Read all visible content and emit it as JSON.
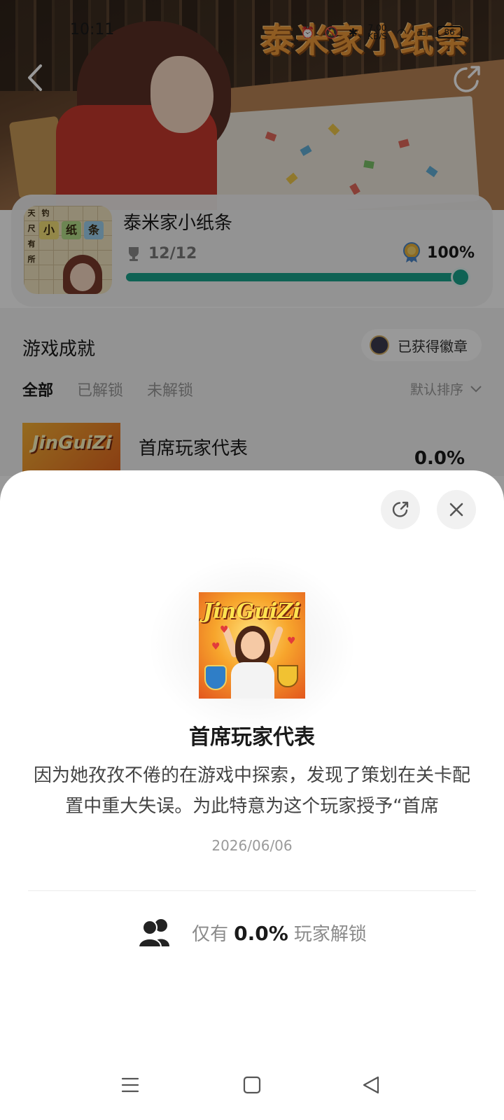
{
  "status_bar": {
    "time": "10:11",
    "network_speed": "7.00",
    "network_unit": "KB/S",
    "battery": "86"
  },
  "hero": {
    "banner_title": "泰米家小纸条"
  },
  "game": {
    "name": "泰米家小纸条",
    "trophies": "12/12",
    "completion": "100%",
    "completion_fraction": 1.0,
    "thumb_tiles": [
      "小",
      "纸",
      "条"
    ],
    "thumb_side_chars": [
      "天",
      "钓",
      "尺",
      "有",
      "所"
    ]
  },
  "achievements": {
    "title": "游戏成就",
    "badge_button": "已获得徽章",
    "tabs": [
      "全部",
      "已解锁",
      "未解锁"
    ],
    "sort_label": "默认排序",
    "first_item": {
      "logo": "JinGuiZi",
      "name": "首席玩家代表",
      "percent": "0.0%"
    }
  },
  "sheet": {
    "image_logo": "JinGuiZi",
    "title": "首席玩家代表",
    "description": "因为她孜孜不倦的在游戏中探索，发现了策划在关卡配置中重大失误。为此特意为这个玩家授予“首席",
    "date": "2026/06/06",
    "unlock_prefix": "仅有",
    "unlock_percent": "0.0%",
    "unlock_suffix": "玩家解锁"
  },
  "icons": {
    "back": "chevron-left-icon",
    "share": "share-icon",
    "close": "close-icon",
    "trophy": "trophy-icon",
    "medal": "medal-icon",
    "users": "users-icon",
    "sort": "chevron-down-icon"
  },
  "colors": {
    "accent": "#1aa38d",
    "banner_title": "#ef9a3a"
  }
}
